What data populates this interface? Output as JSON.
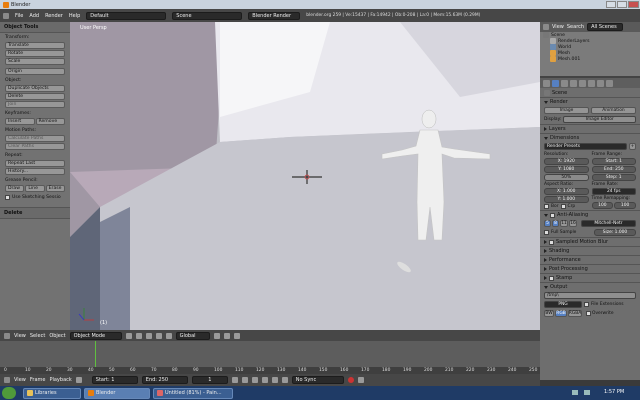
{
  "window": {
    "title": "Blender"
  },
  "menubar": {
    "items": [
      "File",
      "Add",
      "Render",
      "Help"
    ],
    "layout": "Default",
    "scene": "Scene",
    "engine": "Blender Render",
    "info": "blender.org 259 | Ve:15437 | Fa:14942 | Ob:0-208 | La:0 | Mem:15.63M (0.29M)"
  },
  "left_panel": {
    "header": "Object Tools",
    "transform_label": "Transform:",
    "transform_buttons": [
      "Translate",
      "Rotate",
      "Scale"
    ],
    "origin_button": "Origin",
    "object_label": "Object:",
    "object_buttons": [
      "Duplicate Objects",
      "Delete",
      "Join"
    ],
    "keyframes_label": "Keyframes:",
    "keyframe_insert": "Insert",
    "keyframe_remove": "Remove",
    "motion_label": "Motion Paths:",
    "motion_buttons": [
      "Calculate Paths",
      "Clear Paths"
    ],
    "repeat_label": "Repeat:",
    "repeat_buttons": [
      "Repeat Last",
      "History..."
    ],
    "grease_label": "Grease Pencil:",
    "grease_draw": "Draw",
    "grease_line": "Line",
    "grease_erase": "Erase",
    "sketching": "Use Sketching Sessio",
    "delete_header": "Delete"
  },
  "viewport": {
    "label": "User Persp",
    "object_label": "(1)"
  },
  "viewport_header": {
    "items": [
      "View",
      "Select",
      "Object"
    ],
    "mode": "Object Mode",
    "orientation": "Global"
  },
  "outliner": {
    "view": "View",
    "search": "Search",
    "scenes": "All Scenes",
    "rows": [
      "Scene",
      "RenderLayers",
      "World",
      "Mesh",
      "Mesh.001"
    ]
  },
  "properties": {
    "scene_label": "Scene",
    "render_header": "Render",
    "image_button": "Image",
    "animation_button": "Animation",
    "display_label": "Display:",
    "display_value": "Image Editor",
    "layers_header": "Layers",
    "dimensions_header": "Dimensions",
    "render_presets": "Render Presets",
    "resolution_label": "Resolution:",
    "res_x": "X: 1920",
    "res_y": "Y: 1080",
    "res_percent": "50%",
    "frame_range_label": "Frame Range:",
    "start": "Start: 1",
    "end": "End: 250",
    "step": "Step: 1",
    "aspect_label": "Aspect Ratio:",
    "aspect_x": "X: 1.000",
    "aspect_y": "Y: 1.000",
    "frame_rate_label": "Frame Rate:",
    "fps": "24 fps",
    "remap_label": "Time Remapping:",
    "remap_old": "100",
    "remap_new": "100",
    "border": "Bor",
    "crop": "Crp",
    "aa_header": "Anti-Aliasing",
    "aa_samples": [
      "5",
      "8",
      "11",
      "16"
    ],
    "aa_filter": "Mitchell-Netr",
    "full_sample": "Full Sample",
    "aa_size": "Size: 1.000",
    "sections": [
      "Sampled Motion Blur",
      "Shading",
      "Performance",
      "Post Processing",
      "Stamp"
    ],
    "output_header": "Output",
    "output_path": "/tmp\\",
    "format": "PNG",
    "file_ext": "File Extensions",
    "color_modes": [
      "BW",
      "RGB",
      "RGBA"
    ],
    "overwrite": "Overwrite"
  },
  "timeline": {
    "ruler": [
      "0",
      "10",
      "20",
      "30",
      "40",
      "50",
      "60",
      "70",
      "80",
      "90",
      "100",
      "110",
      "120",
      "130",
      "140",
      "150",
      "160",
      "170",
      "180",
      "190",
      "200",
      "210",
      "220",
      "230",
      "240",
      "250"
    ],
    "header_items": [
      "View",
      "Frame",
      "Playback"
    ],
    "start": "Start: 1",
    "end": "End: 250",
    "current": "1",
    "sync": "No Sync"
  },
  "taskbar": {
    "start_icon": "windows-logo",
    "tasks": [
      "Libraries",
      "Blender",
      "Untitled (81%) - Pain..."
    ],
    "time": "1:57 PM"
  },
  "colors": {
    "accent": "#5680c2",
    "viewport_bg": "#bfbfc6",
    "taskbar": "#1f3b66"
  }
}
